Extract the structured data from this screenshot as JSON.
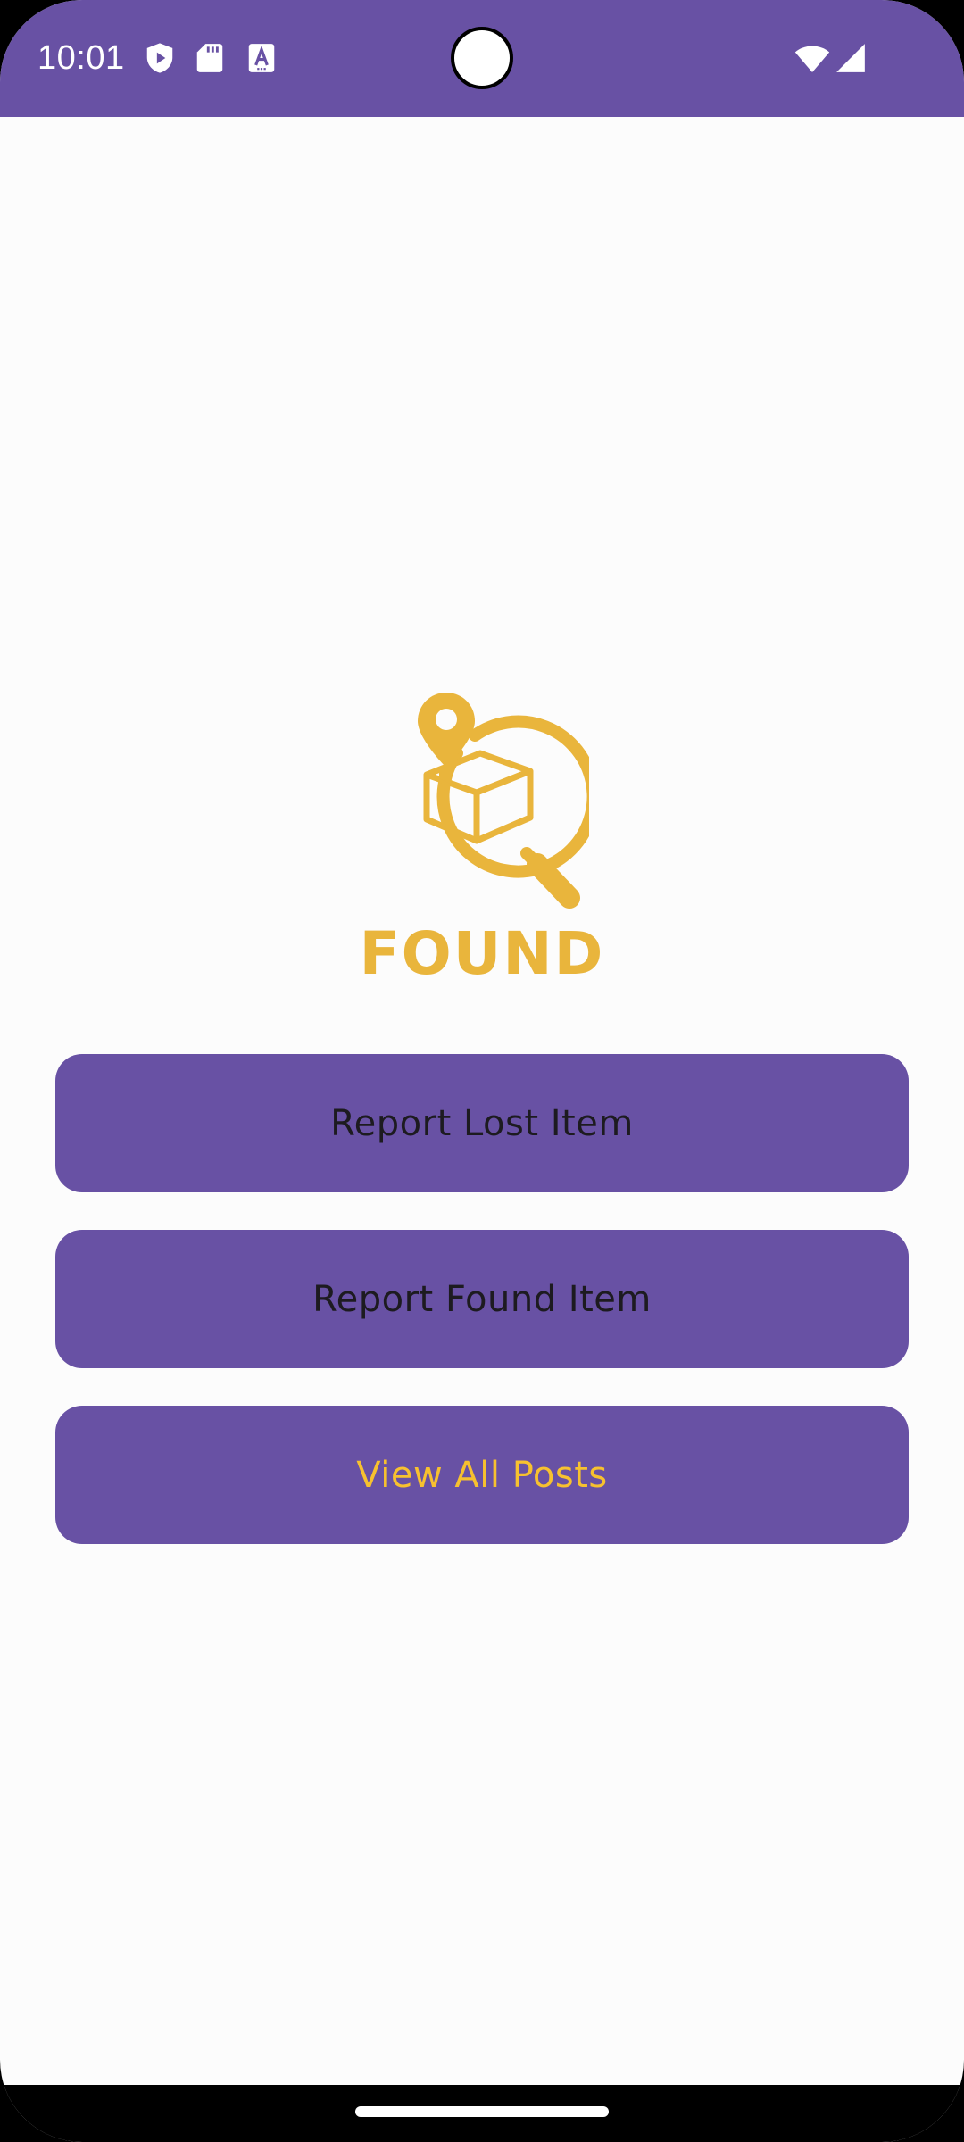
{
  "status_bar": {
    "time": "10:01",
    "background_color": "#6851a4",
    "left_icons": [
      "play-protect-icon",
      "sd-card-icon",
      "font-a-icon"
    ],
    "right_icons": [
      "wifi-icon",
      "cellular-signal-icon"
    ]
  },
  "app": {
    "logo_text": "FOUND",
    "logo_icon": "map-pin-package-magnifier-icon",
    "brand_color": "#e9b53c",
    "background_color": "#fcfcfc"
  },
  "buttons": {
    "report_lost": {
      "label": "Report Lost Item",
      "text_color": "#1d1b20"
    },
    "report_found": {
      "label": "Report Found Item",
      "text_color": "#1d1b20"
    },
    "view_all": {
      "label": "View All Posts",
      "text_color": "#f7c12f"
    },
    "background_color": "#6851a4"
  },
  "navigation": {
    "handle": "home-gesture-handle"
  }
}
